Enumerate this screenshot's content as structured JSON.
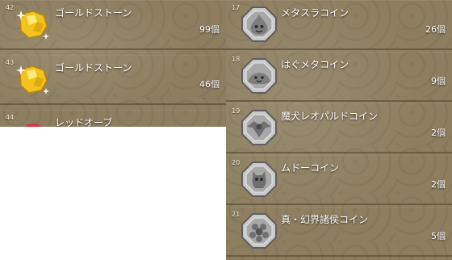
{
  "left_list": {
    "items": [
      {
        "number": "42",
        "name": "ゴールドストーン",
        "count": "99個",
        "icon": "gold-stone-icon"
      },
      {
        "number": "43",
        "name": "ゴールドストーン",
        "count": "46個",
        "icon": "gold-stone-icon"
      },
      {
        "number": "44",
        "name": "レッドオーブ",
        "count": "",
        "icon": "red-orb-icon"
      }
    ]
  },
  "right_list": {
    "items": [
      {
        "number": "17",
        "name": "メタスラコイン",
        "count": "26個",
        "icon": "metal-slime-coin-icon"
      },
      {
        "number": "18",
        "name": "はぐメタコイン",
        "count": "9個",
        "icon": "liquid-metal-slime-coin-icon"
      },
      {
        "number": "19",
        "name": "魔犬レオパルドコイン",
        "count": "2個",
        "icon": "leopard-dog-coin-icon"
      },
      {
        "number": "20",
        "name": "ムドーコイン",
        "count": "2個",
        "icon": "mudo-coin-icon"
      },
      {
        "number": "21",
        "name": "真・幻界諸侯コイン",
        "count": "5個",
        "icon": "illusion-lords-coin-icon"
      }
    ]
  }
}
